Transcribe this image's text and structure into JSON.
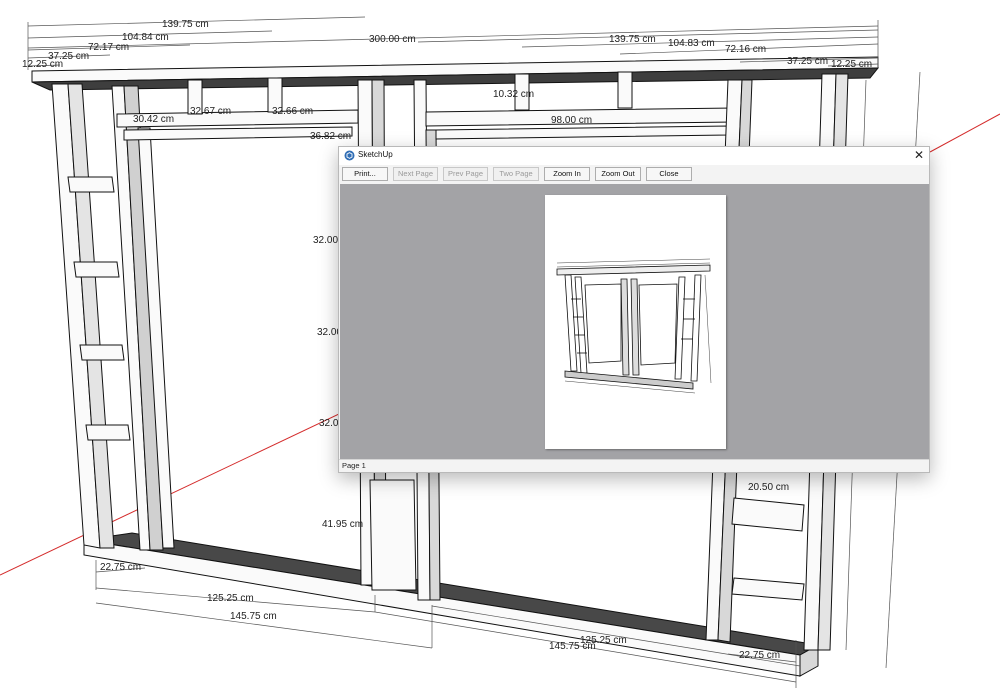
{
  "dialog": {
    "title": "SketchUp",
    "buttons": {
      "print": "Print...",
      "next_page": "Next Page",
      "prev_page": "Prev Page",
      "two_page": "Two Page",
      "zoom_in": "Zoom In",
      "zoom_out": "Zoom Out",
      "close": "Close"
    },
    "disabled_buttons": [
      "Next Page",
      "Prev Page",
      "Two Page"
    ],
    "status": "Page 1",
    "close_icon": "close-icon",
    "app_icon": "sketchup-icon"
  },
  "model": {
    "top_dims": [
      "139.75 cm",
      "104.84 cm",
      "72.17 cm",
      "37.25 cm",
      "12.25 cm",
      "300.00 cm",
      "139.75 cm",
      "104.83 cm",
      "72.16 cm",
      "37.25 cm",
      "12.25 cm"
    ],
    "interior_dims": [
      "30.42 cm",
      "32.67 cm",
      "32.66 cm",
      "36.82 cm",
      "10.32 cm",
      "98.00 cm",
      "32.00",
      "32.00",
      "32.0",
      "41.95 cm",
      "20.50 cm"
    ],
    "bottom_dims": [
      "22.75 cm",
      "125.25 cm",
      "145.75 cm",
      "125.25 cm",
      "145.75 cm",
      "22.75 cm"
    ]
  },
  "colors": {
    "axis_red": "#d42b2b",
    "preview_gray": "#a3a3a6",
    "wood_face": "#fafafa",
    "wood_shadow": "#4a4a4a"
  }
}
